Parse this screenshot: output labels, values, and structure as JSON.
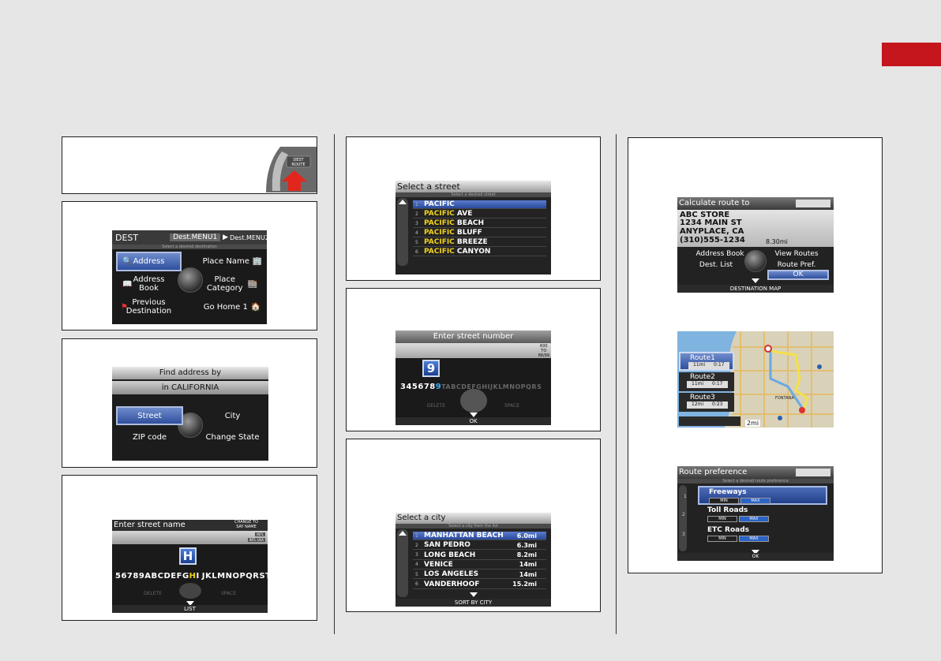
{
  "page": {
    "tab_color": "#c4161c"
  },
  "p1": {
    "button_label": "DEST\nROUTE"
  },
  "p2": {
    "title": "DEST",
    "menu1": "Dest.MENU1",
    "menu2": "Dest.MENU2",
    "hint": "Select a desired destination",
    "address": "Address",
    "place_name": "Place Name",
    "address_book": "Address\nBook",
    "place_category": "Place\nCategory",
    "previous_destination": "Previous\nDestination",
    "go_home": "Go Home 1"
  },
  "p3": {
    "title": "Find address by",
    "state": "in CALIFORNIA",
    "street": "Street",
    "city": "City",
    "zip": "ZIP code",
    "change_state": "Change State"
  },
  "p4": {
    "title": "Enter street name",
    "change_to": "CHANGE TO\nSAY NAME",
    "ver1": "INTL",
    "ver2": "INTL USA",
    "key": "H",
    "chars_a": "56789",
    "chars_b": "ABCDEFG",
    "chars_c": "I",
    "chars_d": "JKLMNOPQRSTU",
    "delete": "DELETE",
    "space": "SPACE",
    "footer": "LIST"
  },
  "p5": {
    "title": "Select a street",
    "hint": "Select a desired street",
    "rows": [
      {
        "n": "1",
        "a": "PACIFIC",
        "b": ""
      },
      {
        "n": "2",
        "a": "PACIFIC",
        "b": " AVE"
      },
      {
        "n": "3",
        "a": "PACIFIC",
        "b": " BEACH"
      },
      {
        "n": "4",
        "a": "PACIFIC",
        "b": " BLUFF"
      },
      {
        "n": "5",
        "a": "PACIFIC",
        "b": " BREEZE"
      },
      {
        "n": "6",
        "a": "PACIFIC",
        "b": " CANYON"
      }
    ]
  },
  "p6": {
    "title": "Enter street number",
    "range": "600\nTO\n88/99",
    "key": "9",
    "chars_a": "345678",
    "chars_b": "9",
    "chars_c": "TABCDEFGHIJKLMNOPQRS",
    "delete": "DELETE",
    "space": "SPACE",
    "footer": "OK"
  },
  "p7": {
    "title": "Select a city",
    "hint": "Select a city from the list",
    "rows": [
      {
        "n": "1",
        "name": "MANHATTAN BEACH",
        "dist": "6.0mi"
      },
      {
        "n": "2",
        "name": "SAN PEDRO",
        "dist": "6.3mi"
      },
      {
        "n": "3",
        "name": "LONG BEACH",
        "dist": "8.2mi"
      },
      {
        "n": "4",
        "name": "VENICE",
        "dist": "14mi"
      },
      {
        "n": "5",
        "name": "LOS ANGELES",
        "dist": "14mi"
      },
      {
        "n": "6",
        "name": "VANDERHOOF",
        "dist": "15.2mi"
      }
    ],
    "footer": "SORT BY CITY"
  },
  "p8": {
    "calc_title": "Calculate route to",
    "store": "ABC STORE",
    "street": "1234 MAIN ST",
    "city": "ANYPLACE, CA",
    "phone": "(310)555-1234",
    "distance": "8.30mi",
    "address_book": "Address Book",
    "dest_list": "Dest. List",
    "view_routes": "View Routes",
    "route_pref": "Route Pref.",
    "ok": "OK",
    "calc_footer": "DESTINATION MAP",
    "routes": [
      {
        "name": "Route1",
        "mi": "11mi",
        "time": "0:17"
      },
      {
        "name": "Route2",
        "mi": "11mi",
        "time": "0:17"
      },
      {
        "name": "Route3",
        "mi": "12mi",
        "time": "0:23"
      }
    ],
    "scale": "2mi",
    "map_city": "FONTANA",
    "pref_title": "Route preference",
    "pref_hint": "Select a desired route preference",
    "prefs": [
      {
        "n": "1",
        "name": "Freeways",
        "min": "MIN",
        "max": "MAX"
      },
      {
        "n": "2",
        "name": "Toll Roads",
        "min": "MIN",
        "max": "MAX"
      },
      {
        "n": "3",
        "name": "ETC Roads",
        "min": "MIN",
        "max": "MAX"
      }
    ],
    "pref_footer": "OK"
  }
}
